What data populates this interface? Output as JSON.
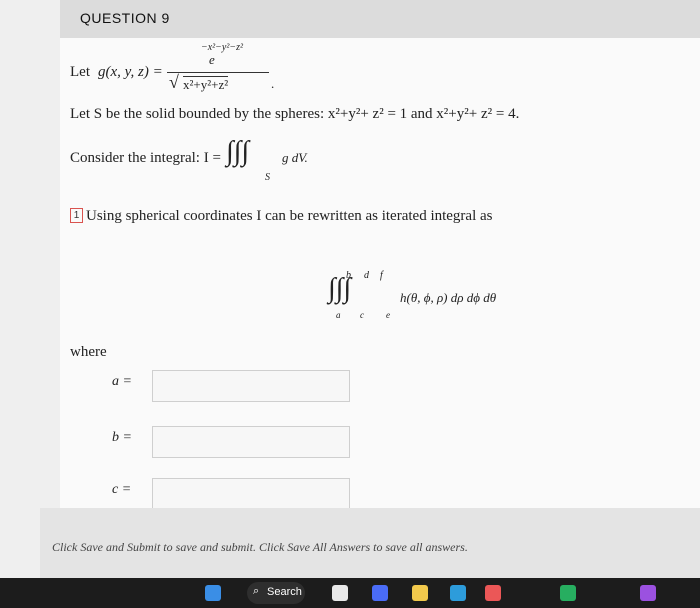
{
  "question": {
    "title": "QUESTION 9"
  },
  "problem": {
    "let_prefix": "Let ",
    "g_def": "g(x, y, z) =",
    "numerator": "e",
    "exponent": "−x²−y²−z²",
    "denominator": "x²+y²+z²",
    "period": ".",
    "solid_text": "Let S be the solid bounded by the spheres: x²+y²+ z² = 1 and x²+y²+ z² = 4.",
    "integral_text": "Consider the integral: I =",
    "integral_symbol": "∫∫∫",
    "integrand": "g dV.",
    "region": "S"
  },
  "part1": {
    "marker": "1",
    "prompt": "Using spherical coordinates I can be rewritten as iterated integral as",
    "iterated_integral": "∫∫∫",
    "upper_b": "b",
    "upper_d": "d",
    "upper_f": "f",
    "lower_a": "a",
    "lower_c": "c",
    "lower_e": "e",
    "integrand": "h(θ, ϕ, ρ) dρ dϕ dθ",
    "where_label": "where",
    "fields": [
      {
        "label": "a =",
        "value": ""
      },
      {
        "label": "b =",
        "value": ""
      },
      {
        "label": "c =",
        "value": ""
      }
    ]
  },
  "footer": {
    "instruction": "Click Save and Submit to save and submit. Click Save All Answers to save all answers."
  },
  "taskbar": {
    "search_label": "Search",
    "icon_colors": {
      "windows": "#3a8ee6",
      "app1": "#e8e8e8",
      "app2": "#4a6cf7",
      "app3": "#f2c94c",
      "app4": "#2d9cdb",
      "app5": "#eb5757",
      "app6": "#27ae60",
      "app7": "#9b51e0"
    }
  }
}
